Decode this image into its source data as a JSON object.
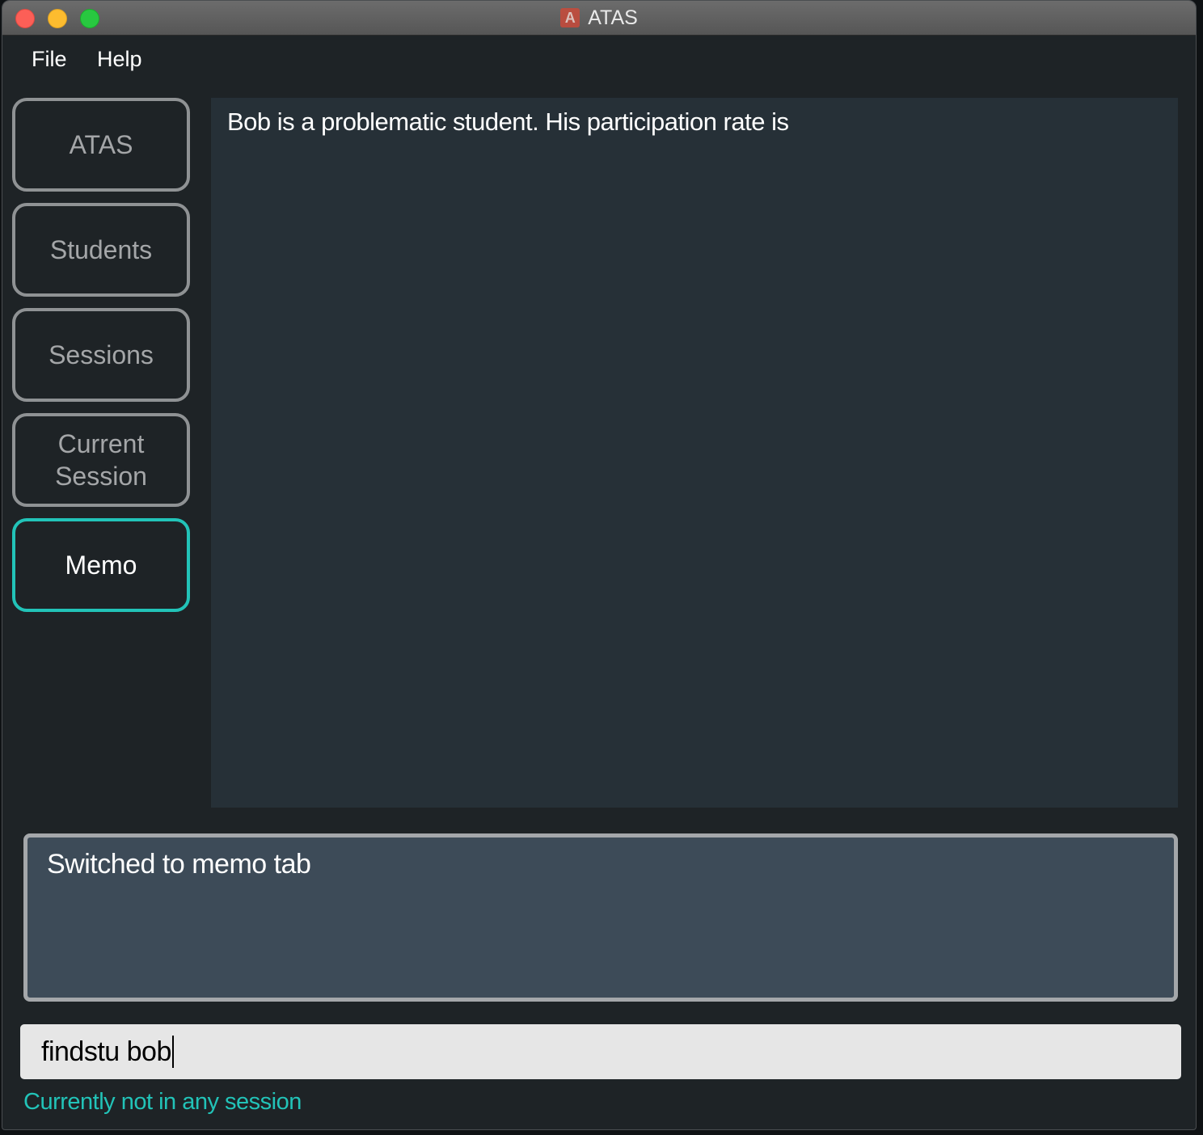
{
  "window": {
    "title": "ATAS",
    "app_icon_letter": "A"
  },
  "menu": {
    "items": [
      "File",
      "Help"
    ]
  },
  "sidebar": {
    "tabs": [
      {
        "label": "ATAS",
        "active": false
      },
      {
        "label": "Students",
        "active": false
      },
      {
        "label": "Sessions",
        "active": false
      },
      {
        "label": "Current\nSession",
        "active": false
      },
      {
        "label": "Memo",
        "active": true
      }
    ],
    "active_color": "#22c3b8"
  },
  "memo": {
    "content": "Bob is a problematic student. His participation rate is"
  },
  "result": {
    "message": "Switched to memo tab"
  },
  "command": {
    "value": "findstu bob"
  },
  "status": {
    "text": "Currently not in any session",
    "color": "#22c3b8"
  }
}
